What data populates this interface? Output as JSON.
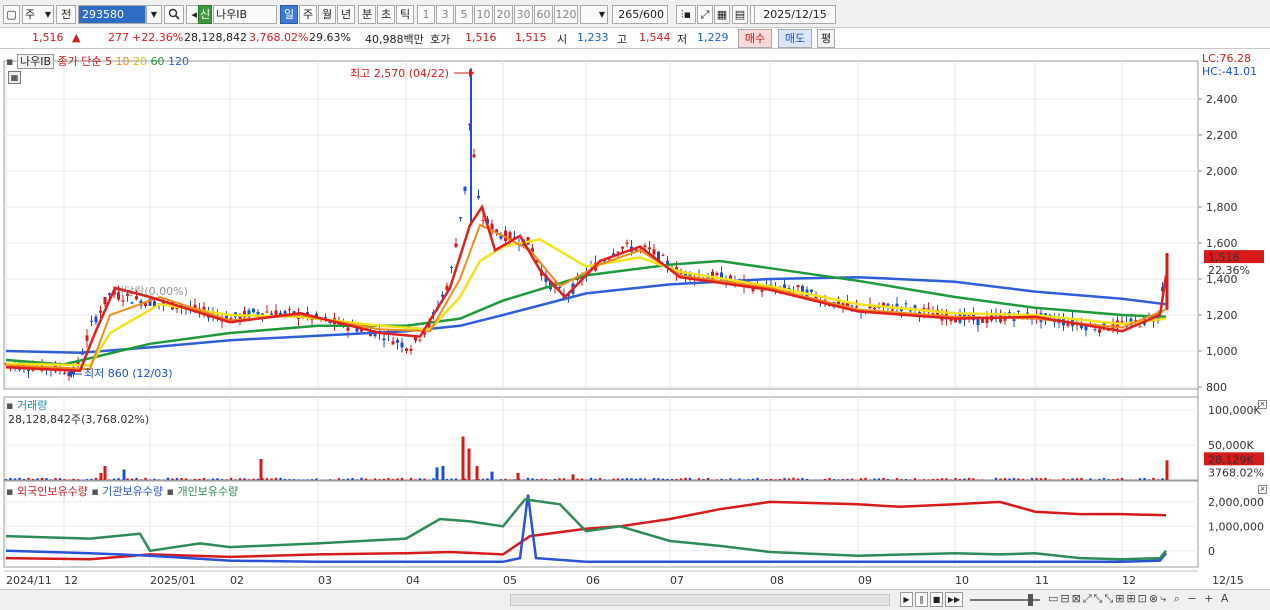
{
  "toolbar": {
    "market": "주",
    "prev_label": "전",
    "code": "293580",
    "stock_badge": "신",
    "stock_name": "나우IB",
    "periods": [
      "일",
      "주",
      "월",
      "년",
      "분",
      "초",
      "틱"
    ],
    "active_period": "일",
    "intervals": [
      "1",
      "3",
      "5",
      "10",
      "20",
      "30",
      "60",
      "120"
    ],
    "count": "265",
    "count_total": "/600",
    "date": "2025/12/15"
  },
  "quote": {
    "price": "1,516",
    "change": "277",
    "change_pct": "+22.36%",
    "volume": "28,128,842",
    "volume_pct": "3,768.02%",
    "turnover": "29.63%",
    "amount": "40,988백만",
    "hoga_label": "호가",
    "ask": "1,516",
    "bid": "1,515",
    "open_label": "시",
    "open": "1,233",
    "high_label": "고",
    "high": "1,544",
    "low_label": "저",
    "low": "1,229",
    "buy_btn": "매수",
    "sell_btn": "매도",
    "eval_btn": "평"
  },
  "price_panel": {
    "name_tag": "나우IB",
    "ma_label": "종가 단순",
    "ma_periods": [
      "5",
      "10",
      "20",
      "60",
      "120"
    ],
    "lc": "LC:76.28",
    "hc": "HC:-41.01",
    "high_ann": "최고 2,570 (04/22)",
    "low_ann": "최저 860 (12/03)",
    "faint_ann": "비달락(0.00%)",
    "price_tag": "1,516",
    "pct_tag": "22.36%",
    "y_ticks": [
      "2,400",
      "2,200",
      "2,000",
      "1,800",
      "1,600",
      "1,400",
      "1,200",
      "1,000",
      "800"
    ]
  },
  "volume_panel": {
    "title": "거래량",
    "value_text": "28,128,842주(3,768.02%)",
    "y_ticks": [
      "100,000K",
      "50,000K"
    ],
    "vol_tag": "28,129K",
    "vol_pct_tag": "3768.02%"
  },
  "holdings_panel": {
    "series": [
      {
        "name": "외국인보유수량",
        "color": "#d61a1a"
      },
      {
        "name": "기관보유수량",
        "color": "#2a52d6"
      },
      {
        "name": "개인보유수량",
        "color": "#2e8b57"
      }
    ],
    "y_ticks": [
      "2,000,000",
      "1,000,000",
      "0"
    ]
  },
  "x_axis": {
    "labels": [
      "2024/11",
      "12",
      "2025/01",
      "02",
      "03",
      "04",
      "05",
      "06",
      "07",
      "08",
      "09",
      "10",
      "11",
      "12"
    ],
    "right_label": "12/15"
  },
  "colors": {
    "up": "#d61a1a",
    "down": "#1c4fd0",
    "ma5": "#e0201c",
    "ma10": "#f08c1c",
    "ma20": "#f2e21c",
    "ma60": "#1e9a3c",
    "ma120": "#2e5fd8"
  },
  "chart_data": {
    "type": "line",
    "x": [
      "2024/11",
      "12",
      "2025/01",
      "02",
      "03",
      "04",
      "05",
      "06",
      "07",
      "08",
      "09",
      "10",
      "11",
      "12"
    ],
    "ylim": [
      800,
      2600
    ],
    "series": [
      {
        "name": "5",
        "values": [
          900,
          1150,
          1300,
          1200,
          1150,
          1150,
          1850,
          1550,
          1400,
          1320,
          1250,
          1200,
          1180,
          1516
        ]
      },
      {
        "name": "60",
        "values": [
          950,
          920,
          1080,
          1130,
          1170,
          1150,
          1300,
          1400,
          1480,
          1420,
          1320,
          1230,
          1200,
          1180
        ]
      },
      {
        "name": "120",
        "values": [
          1000,
          990,
          1020,
          1060,
          1090,
          1120,
          1200,
          1330,
          1370,
          1400,
          1410,
          1380,
          1300,
          1250
        ]
      }
    ]
  }
}
